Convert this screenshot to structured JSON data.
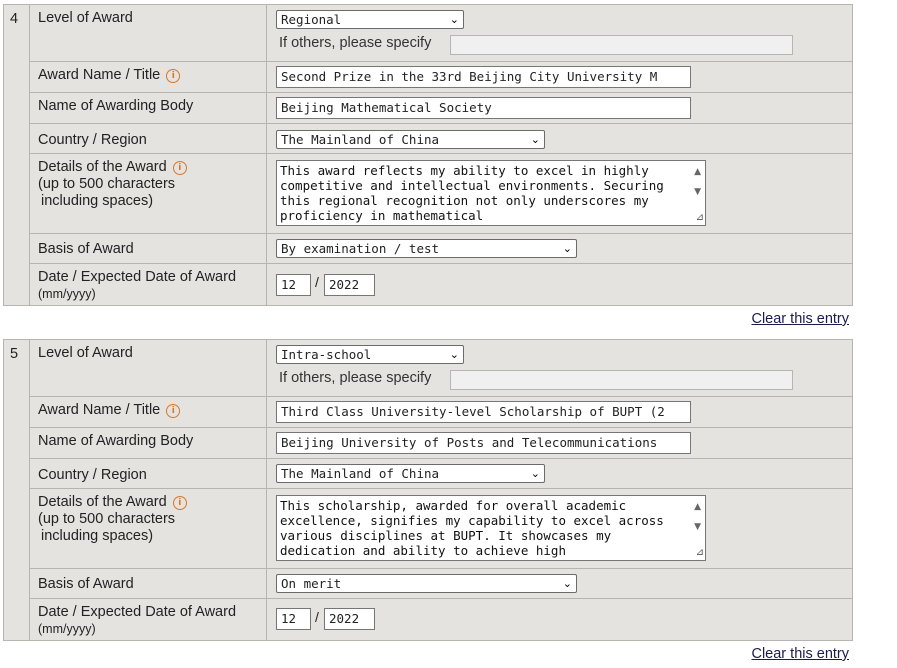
{
  "entries": [
    {
      "number": "4",
      "level_label": "Level of Award",
      "level_value": "Regional",
      "others_label": "If others, please specify",
      "others_value": "",
      "award_name_label": "Award Name / Title",
      "award_name_value": "Second Prize in the 33rd Beijing City University M",
      "awarding_body_label": "Name of Awarding Body",
      "awarding_body_value": "Beijing Mathematical Society",
      "country_label": "Country / Region",
      "country_value": "The Mainland of China",
      "details_label_1": "Details of the Award",
      "details_label_2": "(up to 500 characters",
      "details_label_3": "including spaces)",
      "details_value": "This award reflects my ability to excel in highly competitive and intellectual environments. Securing this regional recognition not only underscores my proficiency in mathematical",
      "basis_label": "Basis of Award",
      "basis_value": "By examination / test",
      "date_label": "Date / Expected Date of Award",
      "date_format": "(mm/yyyy)",
      "date_month": "12",
      "date_year": "2022",
      "clear_label": "Clear this entry"
    },
    {
      "number": "5",
      "level_label": "Level of Award",
      "level_value": "Intra-school",
      "others_label": "If others, please specify",
      "others_value": "",
      "award_name_label": "Award Name / Title",
      "award_name_value": "Third Class University-level Scholarship of BUPT (2",
      "awarding_body_label": "Name of Awarding Body",
      "awarding_body_value": "Beijing University of Posts and Telecommunications",
      "country_label": "Country / Region",
      "country_value": "The Mainland of China",
      "details_label_1": "Details of the Award",
      "details_label_2": "(up to 500 characters",
      "details_label_3": "including spaces)",
      "details_value": "This scholarship, awarded for overall academic excellence, signifies my capability to excel across various disciplines at BUPT. It showcases my dedication and ability to achieve high",
      "basis_label": "Basis of Award",
      "basis_value": "On merit",
      "date_label": "Date / Expected Date of Award",
      "date_format": "(mm/yyyy)",
      "date_month": "12",
      "date_year": "2022",
      "clear_label": "Clear this entry"
    }
  ],
  "icons": {
    "info": "info-icon",
    "dropdown": "chevron-down-icon",
    "scroll_up": "scroll-up-icon",
    "scroll_down": "scroll-down-icon",
    "resize": "resize-grip-icon"
  },
  "colors": {
    "info_icon": "#d8762a",
    "panel_bg": "#e5e3e0",
    "link": "#1b1b4f"
  }
}
